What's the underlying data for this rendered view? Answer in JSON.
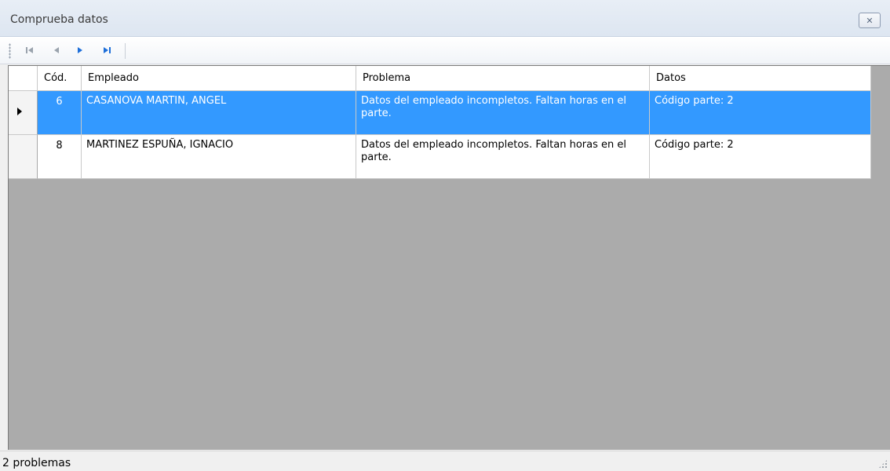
{
  "window": {
    "title": "Comprueba datos",
    "close_glyph": "✕"
  },
  "toolbar": {
    "buttons": [
      {
        "name": "first-record",
        "icon": "first-record-icon"
      },
      {
        "name": "previous-record",
        "icon": "previous-record-icon"
      },
      {
        "name": "next-record",
        "icon": "next-record-icon"
      },
      {
        "name": "last-record",
        "icon": "last-record-icon"
      }
    ]
  },
  "grid": {
    "columns": [
      "Cód.",
      "Empleado",
      "Problema",
      "Datos"
    ],
    "rows": [
      {
        "cod": "6",
        "empleado": "CASANOVA MARTIN, ANGEL",
        "problema": "Datos del empleado incompletos. Faltan horas en el parte.",
        "datos": "Código parte: 2",
        "selected": true
      },
      {
        "cod": "8",
        "empleado": "MARTINEZ ESPUÑA, IGNACIO",
        "problema": "Datos del empleado incompletos. Faltan horas en el parte.",
        "datos": "Código parte: 2",
        "selected": false
      }
    ]
  },
  "status": {
    "text": "2 problemas"
  },
  "colors": {
    "selection": "#3399ff",
    "empty_area": "#ababab",
    "nav_blue": "#1e6fd9"
  }
}
